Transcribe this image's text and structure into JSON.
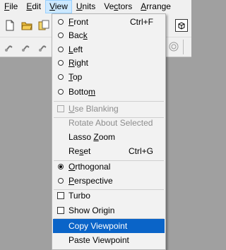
{
  "menubar": [
    {
      "label": "File",
      "key": "F",
      "rest": "ile",
      "active": false
    },
    {
      "label": "Edit",
      "key": "E",
      "rest": "dit",
      "active": false
    },
    {
      "label": "View",
      "key": "V",
      "rest": "iew",
      "active": true
    },
    {
      "label": "Units",
      "key": "U",
      "rest": "nits",
      "active": false
    },
    {
      "label": "Vectors",
      "key": "c",
      "pre": "Ve",
      "rest": "tors",
      "active": false
    },
    {
      "label": "Arrange",
      "key": "A",
      "rest": "rrange",
      "active": false
    }
  ],
  "view_menu": {
    "front": {
      "pre": "",
      "key": "F",
      "rest": "ront",
      "shortcut": "Ctrl+F"
    },
    "back": {
      "pre": "Bac",
      "key": "k",
      "rest": ""
    },
    "left": {
      "pre": "",
      "key": "L",
      "rest": "eft"
    },
    "right": {
      "pre": "",
      "key": "R",
      "rest": "ight"
    },
    "top": {
      "pre": "",
      "key": "T",
      "rest": "op"
    },
    "bottom": {
      "pre": "Botto",
      "key": "m",
      "rest": ""
    },
    "use_blanking": {
      "pre": "",
      "key": "U",
      "rest": "se Blanking"
    },
    "rotate_about_selected": {
      "label": "Rotate About Selected"
    },
    "lasso_zoom": {
      "pre": "Lasso ",
      "key": "Z",
      "rest": "oom"
    },
    "reset": {
      "pre": "Re",
      "key": "s",
      "rest": "et",
      "shortcut": "Ctrl+G"
    },
    "orthogonal": {
      "pre": "",
      "key": "O",
      "rest": "rthogonal"
    },
    "perspective": {
      "pre": "",
      "key": "P",
      "rest": "erspective"
    },
    "turbo": {
      "label": "Turbo"
    },
    "show_origin": {
      "label": "Show Origin"
    },
    "copy_viewpoint": {
      "label": "Copy Viewpoint"
    },
    "paste_viewpoint": {
      "label": "Paste Viewpoint"
    }
  }
}
